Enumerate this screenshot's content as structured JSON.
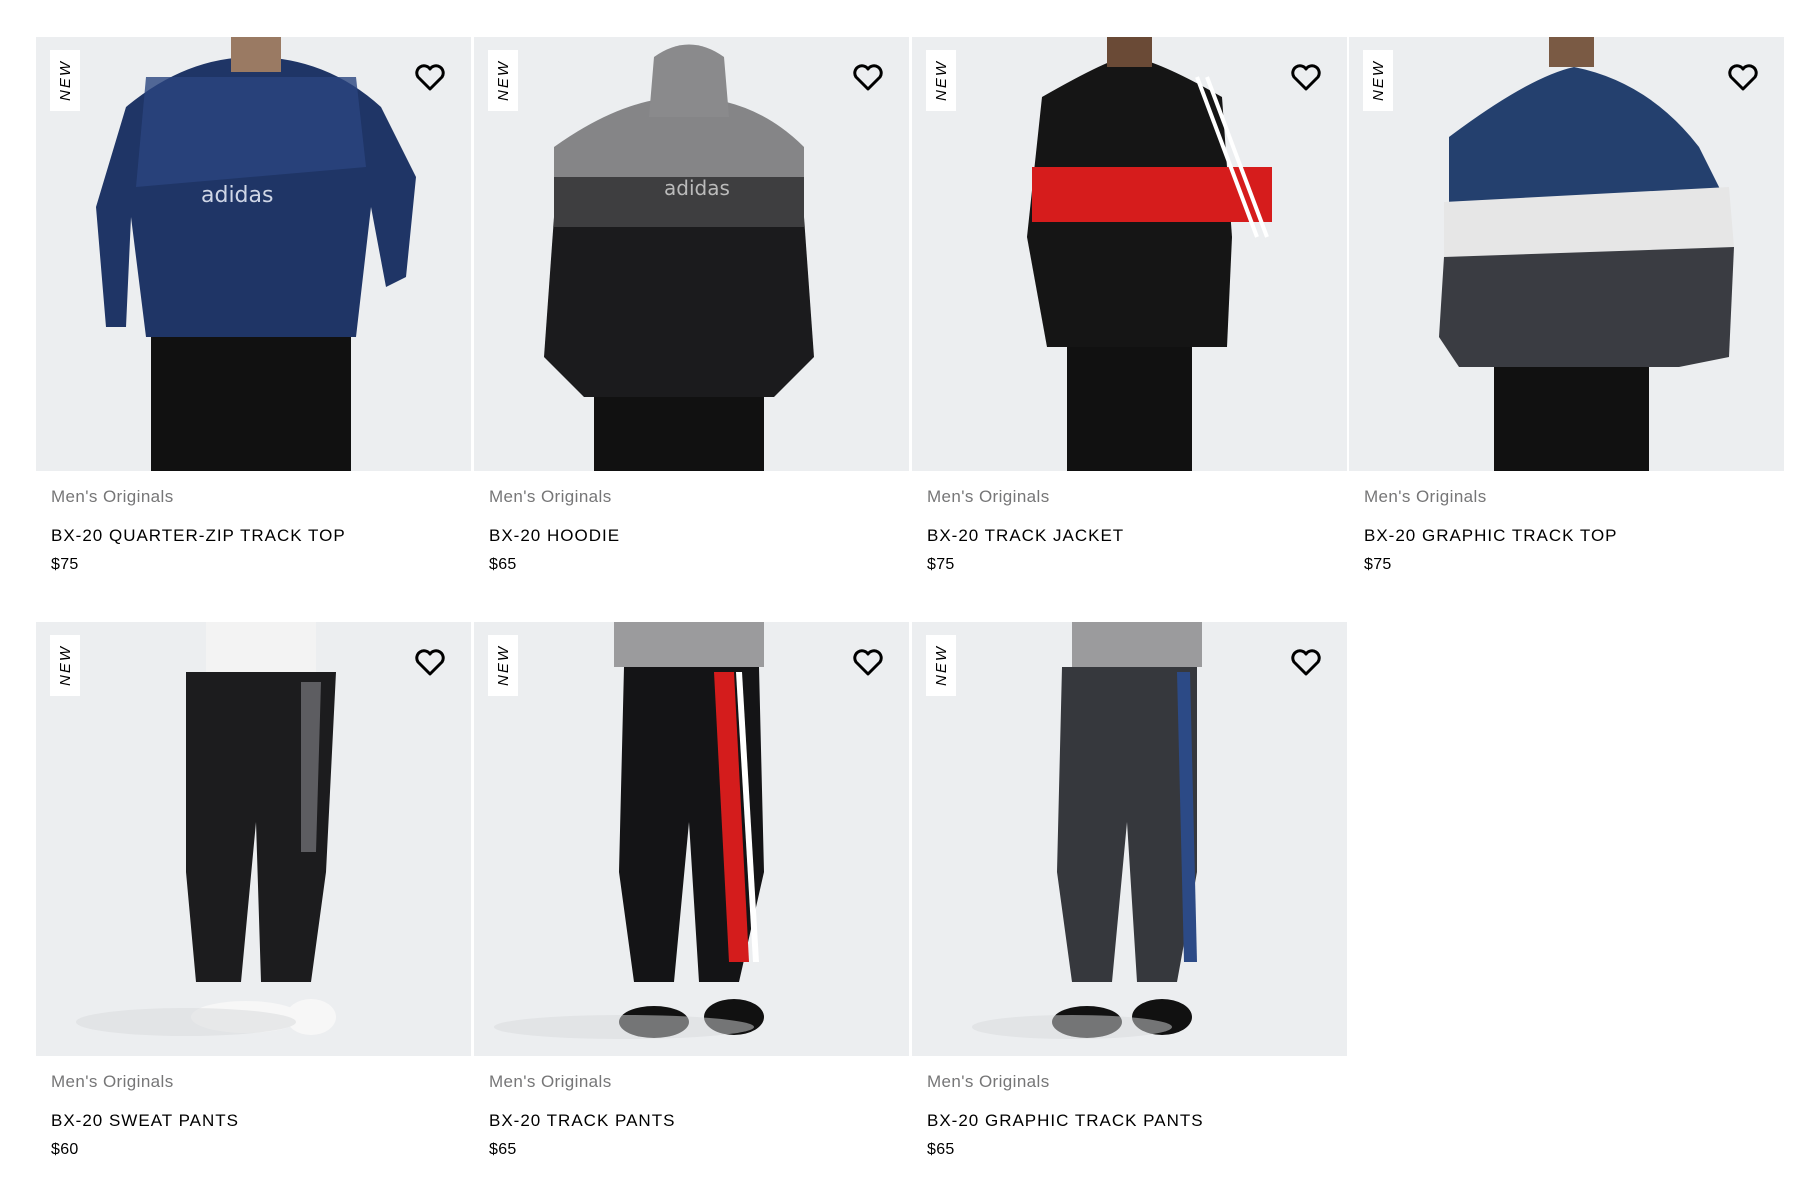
{
  "products": [
    {
      "badge": "NEW",
      "category": "Men's Originals",
      "name": "BX-20 QUARTER-ZIP TRACK TOP",
      "price": "$75"
    },
    {
      "badge": "NEW",
      "category": "Men's Originals",
      "name": "BX-20 HOODIE",
      "price": "$65"
    },
    {
      "badge": "NEW",
      "category": "Men's Originals",
      "name": "BX-20 TRACK JACKET",
      "price": "$75"
    },
    {
      "badge": "NEW",
      "category": "Men's Originals",
      "name": "BX-20 GRAPHIC TRACK TOP",
      "price": "$75"
    },
    {
      "badge": "NEW",
      "category": "Men's Originals",
      "name": "BX-20 SWEAT PANTS",
      "price": "$60"
    },
    {
      "badge": "NEW",
      "category": "Men's Originals",
      "name": "BX-20 TRACK PANTS",
      "price": "$65"
    },
    {
      "badge": "NEW",
      "category": "Men's Originals",
      "name": "BX-20 GRAPHIC TRACK PANTS",
      "price": "$65"
    }
  ],
  "icons": {
    "wishlist": "heart-icon"
  },
  "colors": {
    "image_bg": "#eceef0",
    "category_text": "#767677"
  }
}
